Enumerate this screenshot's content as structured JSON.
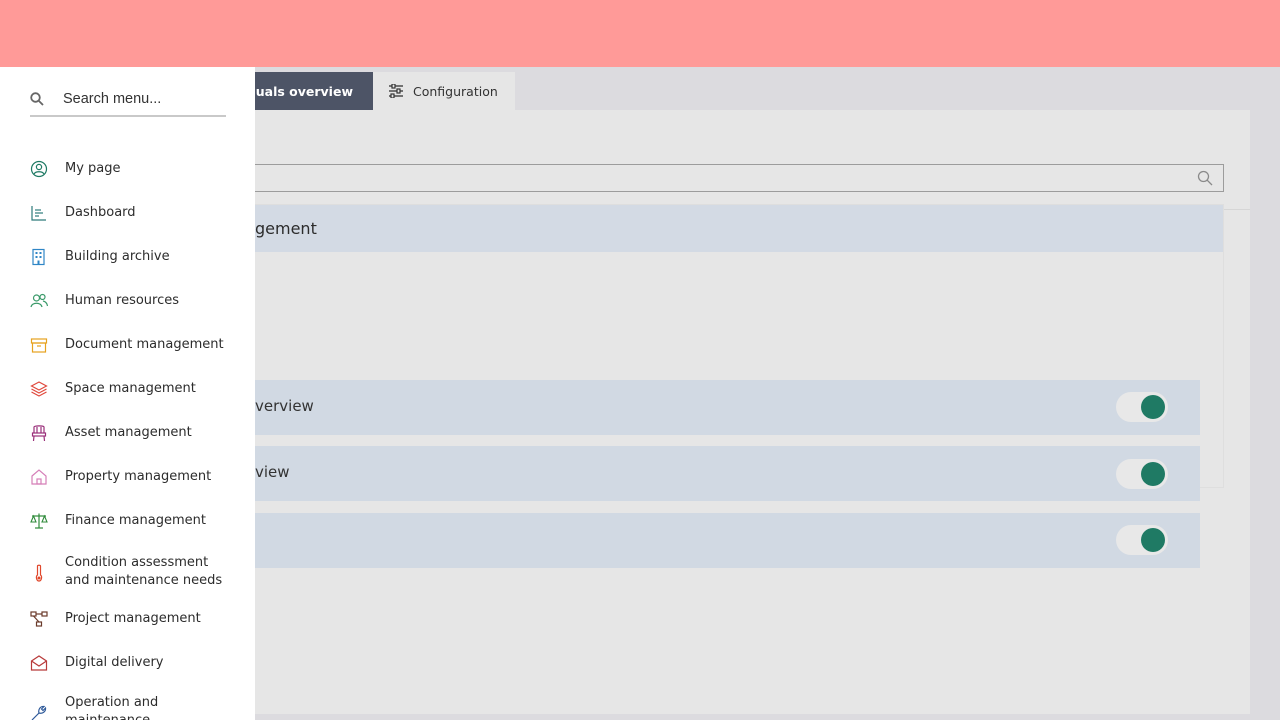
{
  "tabs": {
    "manuals": "Manuals overview",
    "configuration": "Configuration"
  },
  "group": {
    "header": "gement"
  },
  "rows": [
    {
      "label": "verview",
      "enabled": true
    },
    {
      "label": "view",
      "enabled": true
    },
    {
      "label": "",
      "enabled": true
    }
  ],
  "sidebar": {
    "search_placeholder": "Search menu...",
    "items": [
      {
        "label": "My page",
        "icon": "user-circle-icon",
        "color": "#1f7a64"
      },
      {
        "label": "Dashboard",
        "icon": "chart-icon",
        "color": "#2d7a7a"
      },
      {
        "label": "Building archive",
        "icon": "building-icon",
        "color": "#2f86c6"
      },
      {
        "label": "Human resources",
        "icon": "users-icon",
        "color": "#3b9a6a"
      },
      {
        "label": "Document management",
        "icon": "archive-box-icon",
        "color": "#e7a21f"
      },
      {
        "label": "Space management",
        "icon": "layers-icon",
        "color": "#e0483c"
      },
      {
        "label": "Asset management",
        "icon": "chair-icon",
        "color": "#9a2f7a"
      },
      {
        "label": "Property management",
        "icon": "house-icon",
        "color": "#d57fb8"
      },
      {
        "label": "Finance management",
        "icon": "scale-icon",
        "color": "#2f8a3a"
      },
      {
        "label": "Condition assessment and maintenance needs",
        "icon": "thermometer-icon",
        "color": "#e0482c"
      },
      {
        "label": "Project management",
        "icon": "hierarchy-icon",
        "color": "#6a3a2a"
      },
      {
        "label": "Digital delivery",
        "icon": "envelope-open-icon",
        "color": "#b83a3a"
      },
      {
        "label": "Operation and maintenance",
        "icon": "wrench-icon",
        "color": "#2f5a9a"
      }
    ]
  }
}
